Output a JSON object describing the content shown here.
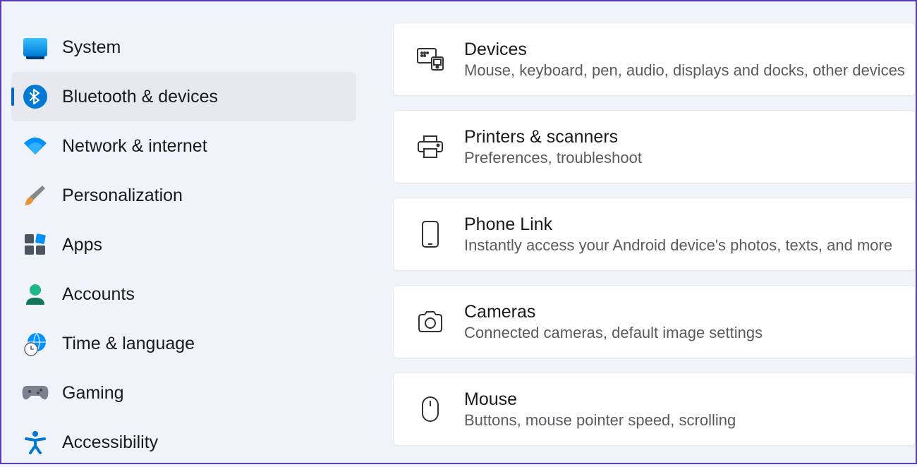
{
  "sidebar": {
    "items": [
      {
        "label": "System"
      },
      {
        "label": "Bluetooth & devices"
      },
      {
        "label": "Network & internet"
      },
      {
        "label": "Personalization"
      },
      {
        "label": "Apps"
      },
      {
        "label": "Accounts"
      },
      {
        "label": "Time & language"
      },
      {
        "label": "Gaming"
      },
      {
        "label": "Accessibility"
      }
    ],
    "active_index": 1
  },
  "cards": [
    {
      "title": "Devices",
      "subtitle": "Mouse, keyboard, pen, audio, displays and docks, other devices"
    },
    {
      "title": "Printers & scanners",
      "subtitle": "Preferences, troubleshoot"
    },
    {
      "title": "Phone Link",
      "subtitle": "Instantly access your Android device's photos, texts, and more"
    },
    {
      "title": "Cameras",
      "subtitle": "Connected cameras, default image settings"
    },
    {
      "title": "Mouse",
      "subtitle": "Buttons, mouse pointer speed, scrolling"
    }
  ],
  "annotation": {
    "arrow_color": "#8a3ffc",
    "target_card_index": 1
  }
}
